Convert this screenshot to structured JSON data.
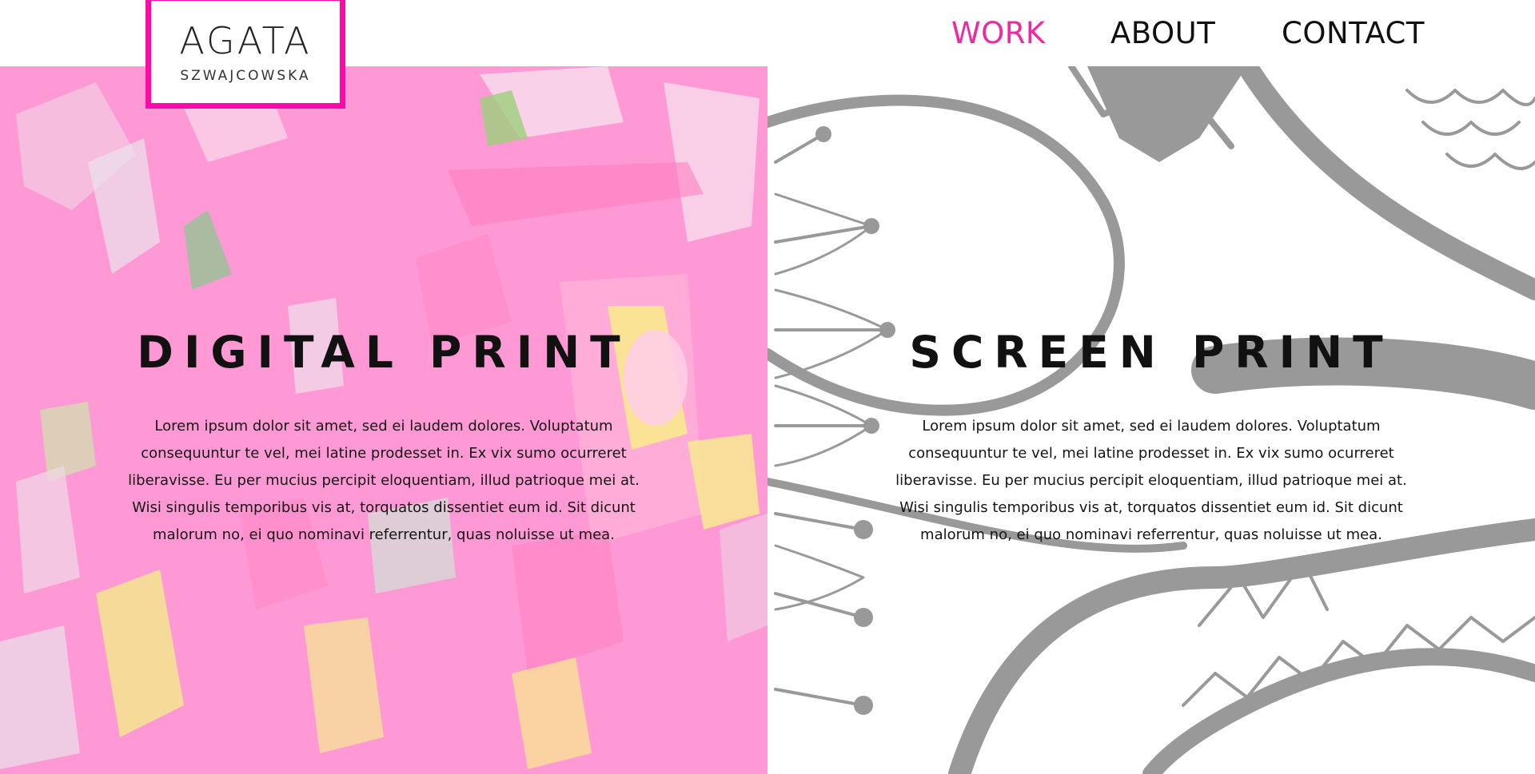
{
  "brand": {
    "name": "AGATA",
    "surname": "SZWAJCOWSKA"
  },
  "nav": {
    "items": [
      "WORK",
      "ABOUT",
      "CONTACT"
    ],
    "active": "WORK"
  },
  "panels": [
    {
      "title": "DIGITAL PRINT",
      "text": "Lorem ipsum dolor sit amet, sed ei laudem dolores. Voluptatum consequuntur te vel, mei latine prodesset in. Ex vix sumo ocurreret liberavisse. Eu per mucius percipit eloquentiam, illud patrioque mei at. Wisi singulis temporibus vis at, torquatos dissentiet eum id. Sit dicunt malorum no, ei quo nominavi referrentur, quas noluisse ut mea."
    },
    {
      "title": "SCREEN PRINT",
      "text": "Lorem ipsum dolor sit amet, sed ei laudem dolores. Voluptatum consequuntur te vel, mei latine prodesset in. Ex vix sumo ocurreret liberavisse. Eu per mucius percipit eloquentiam, illud patrioque mei at. Wisi singulis temporibus vis at, torquatos dissentiet eum id. Sit dicunt malorum no, ei quo nominavi referrentur, quas noluisse ut mea."
    }
  ],
  "colors": {
    "accent": "#ff0aa8",
    "nav_active": "#ee2aa2",
    "left_bg": "#ff99d5",
    "right_art": "#999999"
  }
}
